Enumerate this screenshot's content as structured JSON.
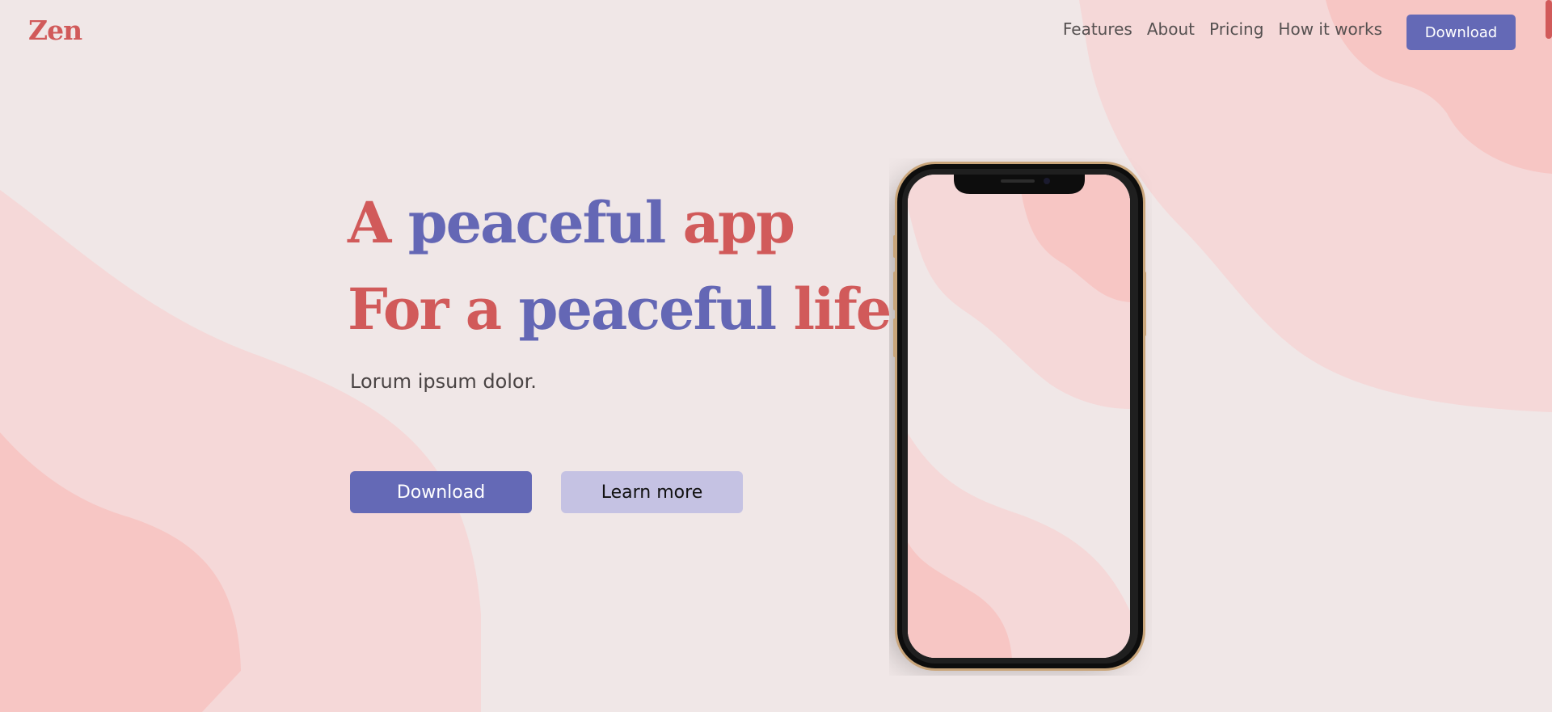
{
  "brand": {
    "logo_text": "Zen",
    "colors": {
      "accent_red": "#d15a5a",
      "accent_blue": "#6469b6",
      "secondary_button": "#c5c2e3",
      "background": "#f0e7e7"
    }
  },
  "nav": {
    "items": [
      {
        "label": "Features"
      },
      {
        "label": "About"
      },
      {
        "label": "Pricing"
      },
      {
        "label": "How it works"
      }
    ],
    "download_label": "Download"
  },
  "hero": {
    "title_line1": {
      "w1": "A",
      "w2": "peaceful",
      "w3": "app"
    },
    "title_line2": {
      "w1": "For a",
      "w2": "peaceful",
      "w3": "life"
    },
    "subtitle": "Lorum ipsum dolor.",
    "primary_button": "Download",
    "secondary_button": "Learn more"
  },
  "phone": {
    "icon": "smartphone-mockup"
  }
}
